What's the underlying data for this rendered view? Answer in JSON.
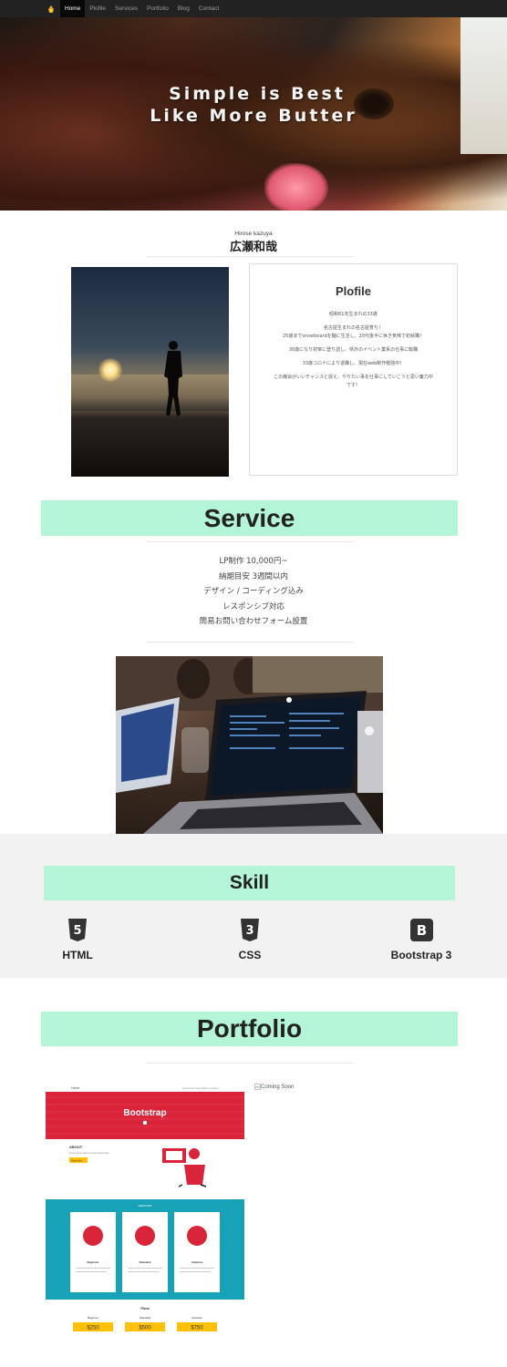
{
  "nav": {
    "items": [
      "Home",
      "Plofile",
      "Services",
      "Portfolio",
      "Blog",
      "Contact"
    ]
  },
  "hero": {
    "line1": "Simple is Best",
    "line2": "Like More Butter"
  },
  "name": {
    "romaji": "Hirose  kazuya",
    "kanji": "広瀬和哉"
  },
  "profile": {
    "title": "Plofile",
    "lines": [
      "昭和61年生まれの33歳",
      "",
      "名古屋生まれの名古屋育ち！",
      "25歳までsnowboardを軸に生活し、20代後半に休き気味で初就職！",
      "",
      "30歳になり初宰に登り詰し、県外のイベント業系の仕事に転職",
      "",
      "33歳コロナにより退職し、現在web制作勉強中！",
      "",
      "この機会がいいチャンスと捉え、やりたい事を仕事にしていこうと思い奮力中",
      "です！"
    ]
  },
  "service": {
    "title": "Service",
    "items": [
      "LP制作 10,000円~",
      "納期目安 3週間以内",
      "デザイン / コーディング込み",
      "レスポンシブ対応",
      "簡易お問い合わせフォーム設置"
    ]
  },
  "skill": {
    "title": "Skill",
    "items": [
      {
        "label": "HTML",
        "icon": "html5-icon",
        "glyph": "5"
      },
      {
        "label": "CSS",
        "icon": "css3-icon",
        "glyph": "3"
      },
      {
        "label": "Bootstrap 3",
        "icon": "bootstrap-icon",
        "glyph": "B"
      }
    ]
  },
  "portfolio": {
    "title": "Portfolio",
    "coming_soon": "Coming Soon",
    "shot": {
      "nav_left": "Home",
      "nav_right": "About  Services  Plans  Contact",
      "hero_title": "Bootstrap",
      "about_title": "ABOUT",
      "about_text": "Lorem ipsum dolor sit amet consectetur",
      "about_button": "Read More",
      "services_title": "SERVICES",
      "cards": [
        "Beginner",
        "Standard",
        "Advance"
      ],
      "plans_title": "Plans",
      "plans": [
        {
          "name": "Beginner",
          "price": "$250"
        },
        {
          "name": "Standard",
          "price": "$500"
        },
        {
          "name": "Advance",
          "price": "$750"
        }
      ]
    }
  },
  "colors": {
    "section_bar": "#b3f5d6",
    "navbar": "#222222",
    "skill_band": "#f2f2f2",
    "pf_red": "#d9243a",
    "pf_teal": "#17a2b8",
    "pf_yellow": "#ffc107"
  }
}
